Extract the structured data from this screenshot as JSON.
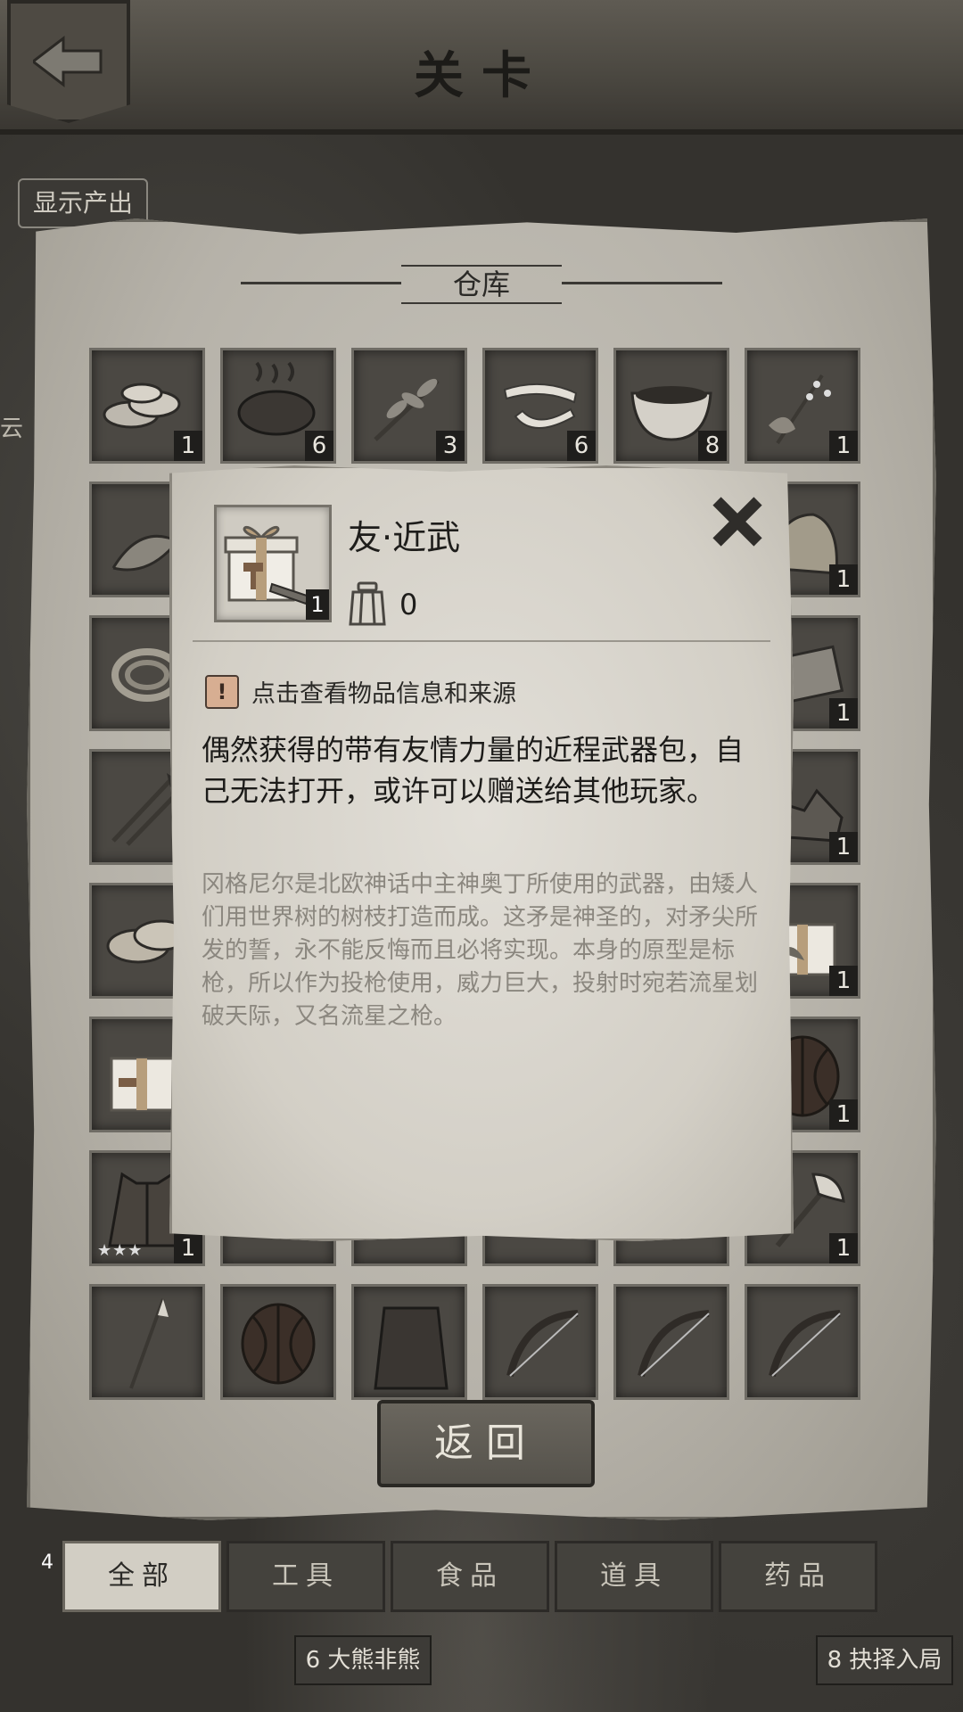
{
  "header": {
    "title": "关卡",
    "back_icon": "back-arrow-icon"
  },
  "map": {
    "show_output_label": "显示产出",
    "side_char": "云",
    "bottom_nodes": [
      {
        "number": "6",
        "label": "大熊非熊"
      },
      {
        "number": "8",
        "label": "抉择入局"
      }
    ],
    "left_badge": "4"
  },
  "warehouse": {
    "title": "仓库",
    "return_label": "返回",
    "tabs": [
      "全部",
      "工具",
      "食品",
      "道具",
      "药品"
    ],
    "active_tab": "全部",
    "items": [
      {
        "icon": "stone-discs-icon",
        "count": "1"
      },
      {
        "icon": "cooked-meat-icon",
        "count": "6"
      },
      {
        "icon": "herb-branch-icon",
        "count": "3"
      },
      {
        "icon": "bandage-icon",
        "count": "6"
      },
      {
        "icon": "soup-bowl-icon",
        "count": "8"
      },
      {
        "icon": "flower-herb-icon",
        "count": "1"
      },
      {
        "icon": "leaf-herb-icon",
        "count": ""
      },
      {
        "icon": "hidden-item-icon",
        "count": ""
      },
      {
        "icon": "hidden-item-icon",
        "count": ""
      },
      {
        "icon": "hidden-item-icon",
        "count": ""
      },
      {
        "icon": "hidden-item-icon",
        "count": ""
      },
      {
        "icon": "cloth-sack-icon",
        "count": "1"
      },
      {
        "icon": "rope-coil-icon",
        "count": ""
      },
      {
        "icon": "hidden-item-icon",
        "count": ""
      },
      {
        "icon": "hidden-item-icon",
        "count": ""
      },
      {
        "icon": "hidden-item-icon",
        "count": ""
      },
      {
        "icon": "hidden-item-icon",
        "count": ""
      },
      {
        "icon": "wood-plank-icon",
        "count": "1"
      },
      {
        "icon": "arrows-icon",
        "count": ""
      },
      {
        "icon": "hidden-item-icon",
        "count": ""
      },
      {
        "icon": "hidden-item-icon",
        "count": ""
      },
      {
        "icon": "hidden-item-icon",
        "count": ""
      },
      {
        "icon": "hidden-item-icon",
        "count": ""
      },
      {
        "icon": "ore-rocks-icon",
        "count": "1"
      },
      {
        "icon": "bread-loaves-icon",
        "count": ""
      },
      {
        "icon": "hidden-item-icon",
        "count": ""
      },
      {
        "icon": "hidden-item-icon",
        "count": ""
      },
      {
        "icon": "hidden-item-icon",
        "count": ""
      },
      {
        "icon": "hidden-item-icon",
        "count": ""
      },
      {
        "icon": "gift-box-herb-icon",
        "count": "1"
      },
      {
        "icon": "gift-box-weapon-icon",
        "count": ""
      },
      {
        "icon": "hidden-item-icon",
        "count": ""
      },
      {
        "icon": "hidden-item-icon",
        "count": ""
      },
      {
        "icon": "hidden-item-icon",
        "count": ""
      },
      {
        "icon": "hidden-item-icon",
        "count": ""
      },
      {
        "icon": "wooden-shield-icon",
        "count": "1"
      },
      {
        "icon": "leather-vest-icon",
        "count": "1",
        "stars": "★★★"
      },
      {
        "icon": "hidden-item-icon",
        "count": ""
      },
      {
        "icon": "hidden-item-icon",
        "count": ""
      },
      {
        "icon": "hidden-item-icon",
        "count": ""
      },
      {
        "icon": "hidden-item-icon",
        "count": ""
      },
      {
        "icon": "battle-axe-icon",
        "count": "1"
      },
      {
        "icon": "spear-icon",
        "count": ""
      },
      {
        "icon": "wooden-shield-icon",
        "count": ""
      },
      {
        "icon": "cloak-icon",
        "count": ""
      },
      {
        "icon": "bow-icon",
        "count": ""
      },
      {
        "icon": "bow-icon",
        "count": ""
      },
      {
        "icon": "bow-icon",
        "count": ""
      }
    ]
  },
  "popup": {
    "item_name": "友·近武",
    "item_count": "1",
    "item_icon": "gift-box-weapon-icon",
    "weight_icon": "backpack-icon",
    "weight_value": "0",
    "close_icon": "close-x-icon",
    "hint_badge": "!",
    "hint_text": "点击查看物品信息和来源",
    "description": "偶然获得的带有友情力量的近程武器包，自己无法打开，或许可以赠送给其他玩家。",
    "lore": "冈格尼尔是北欧神话中主神奥丁所使用的武器，由矮人们用世界树的树枝打造而成。这矛是神圣的，对矛尖所发的誓，永不能反悔而且必将实现。本身的原型是标枪，所以作为投枪使用，威力巨大，投射时宛若流星划破天际，又名流星之枪。"
  },
  "colors": {
    "panel": "#c9c6bd",
    "slot": "#4b4843",
    "count_bg": "#1f1e1c",
    "hint_badge": "#d7ae92"
  }
}
